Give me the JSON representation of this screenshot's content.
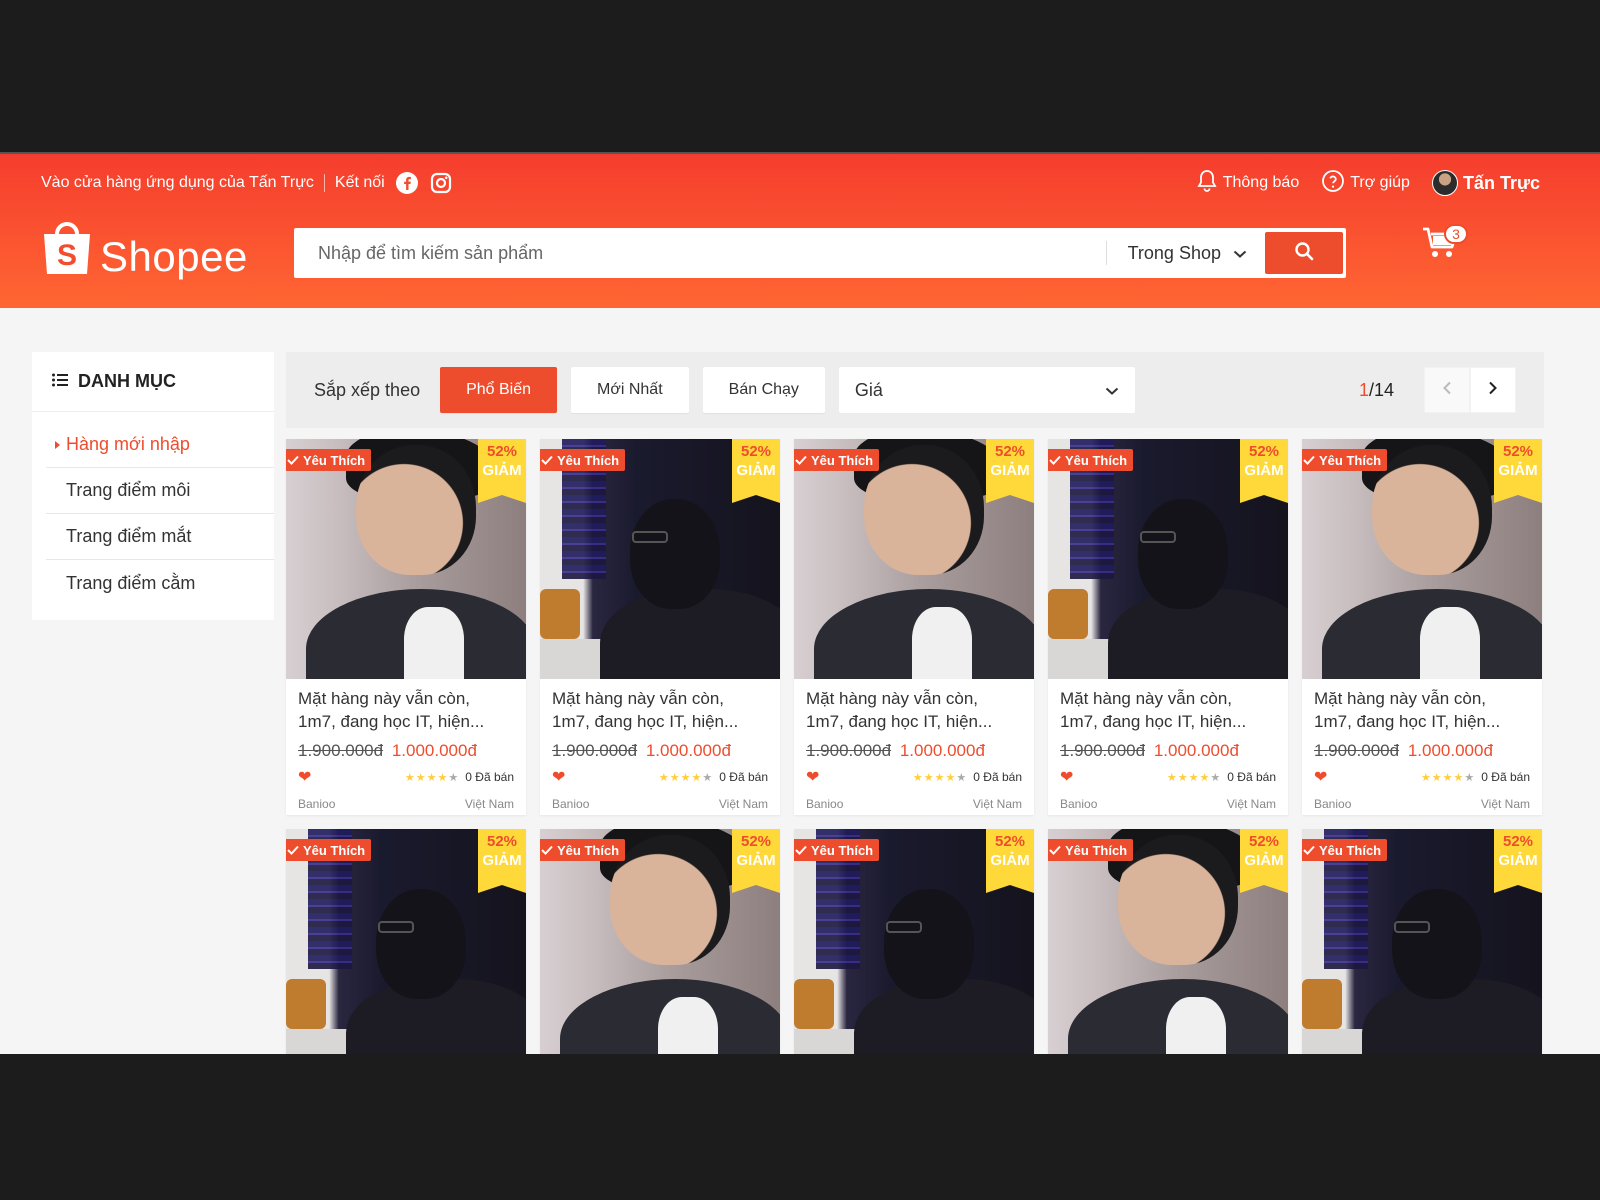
{
  "topbar": {
    "app_store_link": "Vào cửa hàng ứng dụng của Tấn Trực",
    "connect_label": "Kết nối",
    "notifications_label": "Thông báo",
    "help_label": "Trợ giúp",
    "user_name": "Tấn Trực"
  },
  "logo": {
    "text": "Shopee"
  },
  "search": {
    "placeholder": "Nhập để tìm kiếm sản phẩm",
    "scope": "Trong Shop"
  },
  "cart": {
    "count": "3"
  },
  "sidebar": {
    "title": "DANH MỤC",
    "items": [
      {
        "label": "Hàng mới nhập"
      },
      {
        "label": "Trang điểm môi"
      },
      {
        "label": "Trang điểm mắt"
      },
      {
        "label": "Trang điểm cằm"
      }
    ]
  },
  "sort": {
    "label": "Sắp xếp theo",
    "options": [
      "Phổ Biến",
      "Mới Nhất",
      "Bán Chạy"
    ],
    "price_label": "Giá",
    "page_current": "1",
    "page_total": "/14"
  },
  "product": {
    "fav_label": "Yêu Thích",
    "discount_pct": "52%",
    "discount_label": "GIẢM",
    "name_line1": "Mặt hàng này vẫn còn,",
    "name_line2": "1m7, đang học IT, hiện...",
    "old_price": "1.900.000đ",
    "new_price": "1.000.000đ",
    "rating": 4,
    "sold": "0 Đã bán",
    "shop": "Banioo",
    "origin": "Việt Nam"
  },
  "products": [
    {
      "photo": "a",
      "full": true
    },
    {
      "photo": "b",
      "full": true
    },
    {
      "photo": "a",
      "full": true
    },
    {
      "photo": "b",
      "full": true
    },
    {
      "photo": "a",
      "full": true
    },
    {
      "photo": "b",
      "full": false
    },
    {
      "photo": "a",
      "full": false
    },
    {
      "photo": "b",
      "full": false
    },
    {
      "photo": "a",
      "full": false
    },
    {
      "photo": "b",
      "full": false
    }
  ],
  "colors": {
    "brand": "#ee4d2d",
    "badge_yellow": "#ffd839"
  }
}
